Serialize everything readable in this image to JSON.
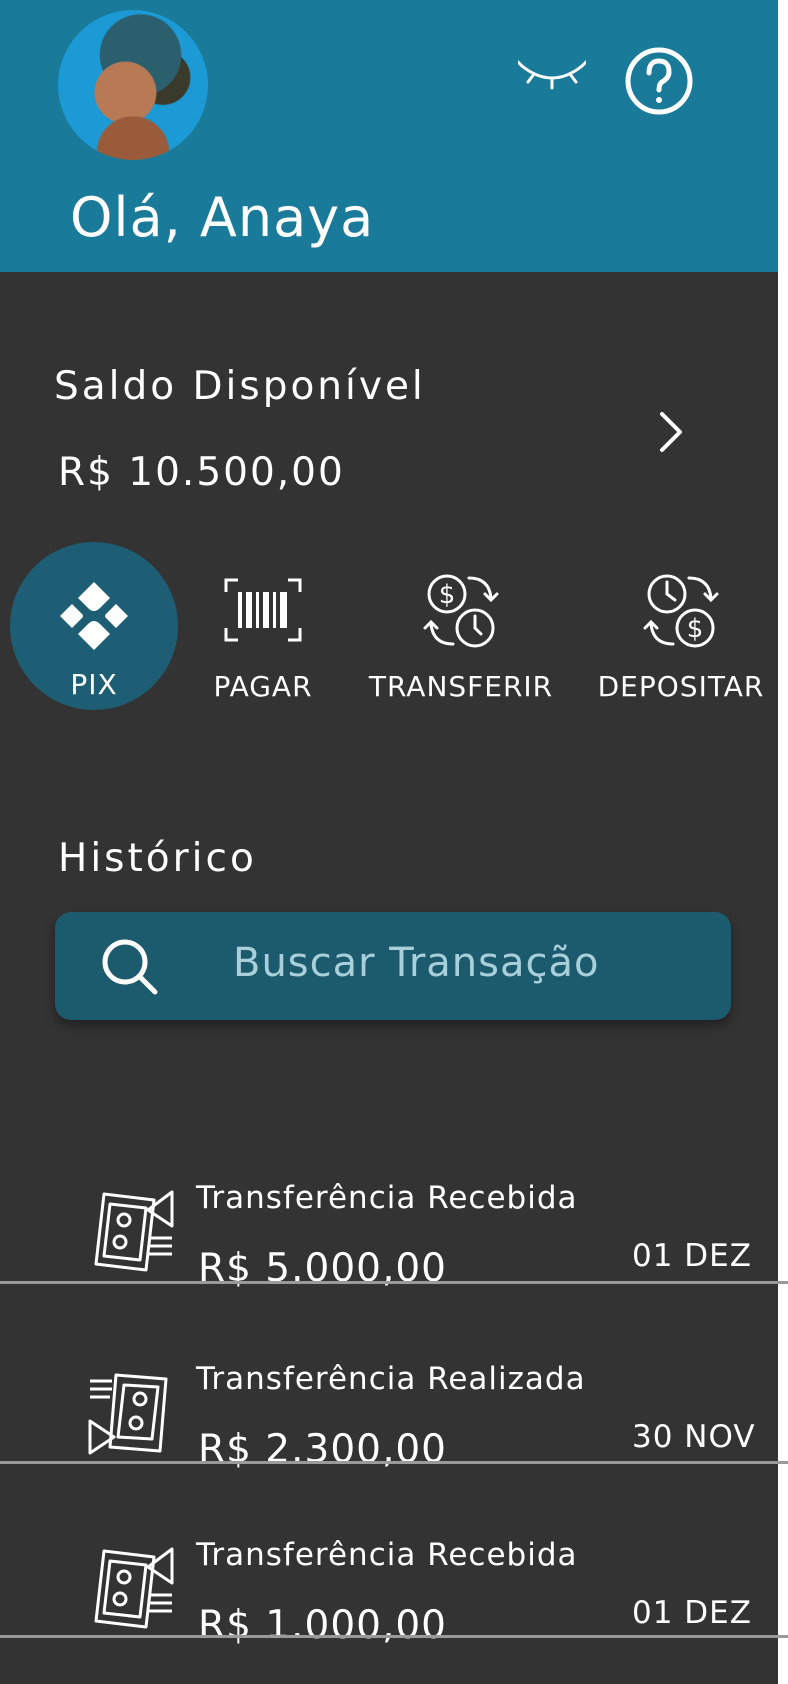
{
  "header": {
    "greeting": "Olá, Anaya",
    "eye_icon": "eye-closed-icon",
    "help_icon": "question-circle-icon",
    "color": "#1a7a99"
  },
  "balance": {
    "label": "Saldo Disponível",
    "value": "R$ 10.500,00"
  },
  "actions": [
    {
      "label": "PIX",
      "icon": "pix-icon"
    },
    {
      "label": "PAGAR",
      "icon": "barcode-icon"
    },
    {
      "label": "TRANSFERIR",
      "icon": "transfer-icon"
    },
    {
      "label": "DEPOSITAR",
      "icon": "deposit-icon"
    }
  ],
  "history": {
    "title": "Histórico",
    "search_placeholder": "Buscar Transação",
    "transactions": [
      {
        "title": "Transferência Recebida",
        "amount": "R$ 5.000,00",
        "date": "01 DEZ",
        "icon": "money-received-icon"
      },
      {
        "title": "Transferência Realizada",
        "amount": "R$ 2.300,00",
        "date": "30 NOV",
        "icon": "money-sent-icon"
      },
      {
        "title": "Transferência Recebida",
        "amount": "R$ 1.000,00",
        "date": "01 DEZ",
        "icon": "money-received-icon"
      }
    ]
  }
}
